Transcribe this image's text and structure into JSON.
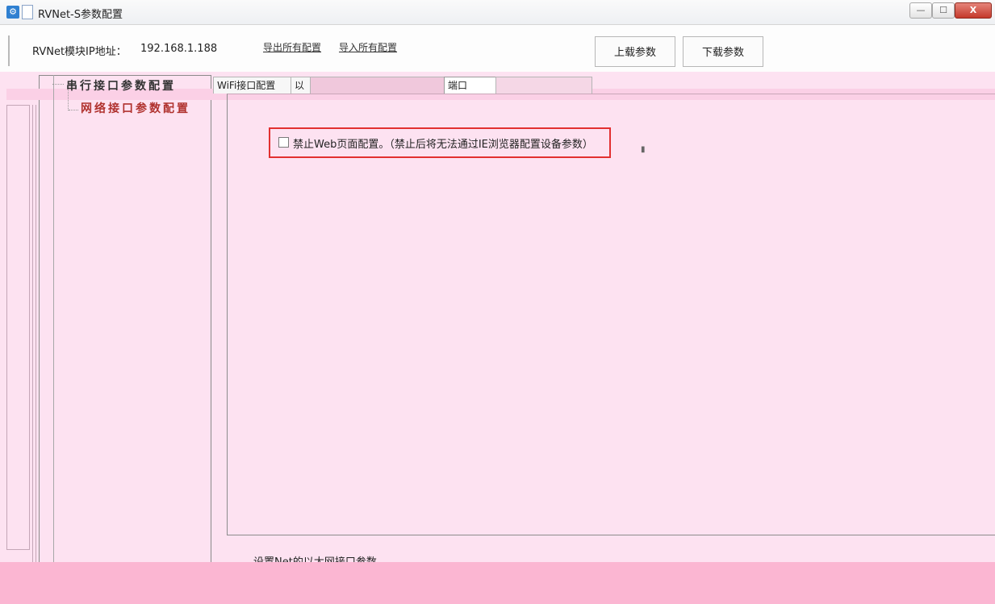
{
  "window": {
    "title": "RVNet-S参数配置",
    "minimize_glyph": "—",
    "maximize_glyph": "☐",
    "close_glyph": "X",
    "app_icon_glyph": "⚙"
  },
  "toolbar": {
    "ip_label": "RVNet模块IP地址：",
    "ip_value": "192.168.1.188",
    "export_link": "导出所有配置",
    "import_link": "导入所有配置",
    "upload_button": "上载参数",
    "download_button": "下载参数"
  },
  "tree": {
    "items": [
      {
        "label": "串行接口参数配置",
        "selected": false
      },
      {
        "label": "网络接口参数配置",
        "selected": true
      }
    ]
  },
  "tabs": [
    {
      "label": "WiFi接口配置"
    },
    {
      "label": "以"
    },
    {
      "label": ""
    },
    {
      "label": "端口"
    },
    {
      "label": ""
    }
  ],
  "content": {
    "checkbox_label": "禁止Web页面配置。（禁止后将无法通过IE浏览器配置设备参数）",
    "checkbox_checked": false
  },
  "status": {
    "text": "设置Net的以太网接口参数。"
  },
  "colors": {
    "background": "#fde2f1",
    "selected_tree_item": "#b0322e",
    "highlight_border": "#e23030",
    "bottom_band": "#fbb6d2"
  }
}
